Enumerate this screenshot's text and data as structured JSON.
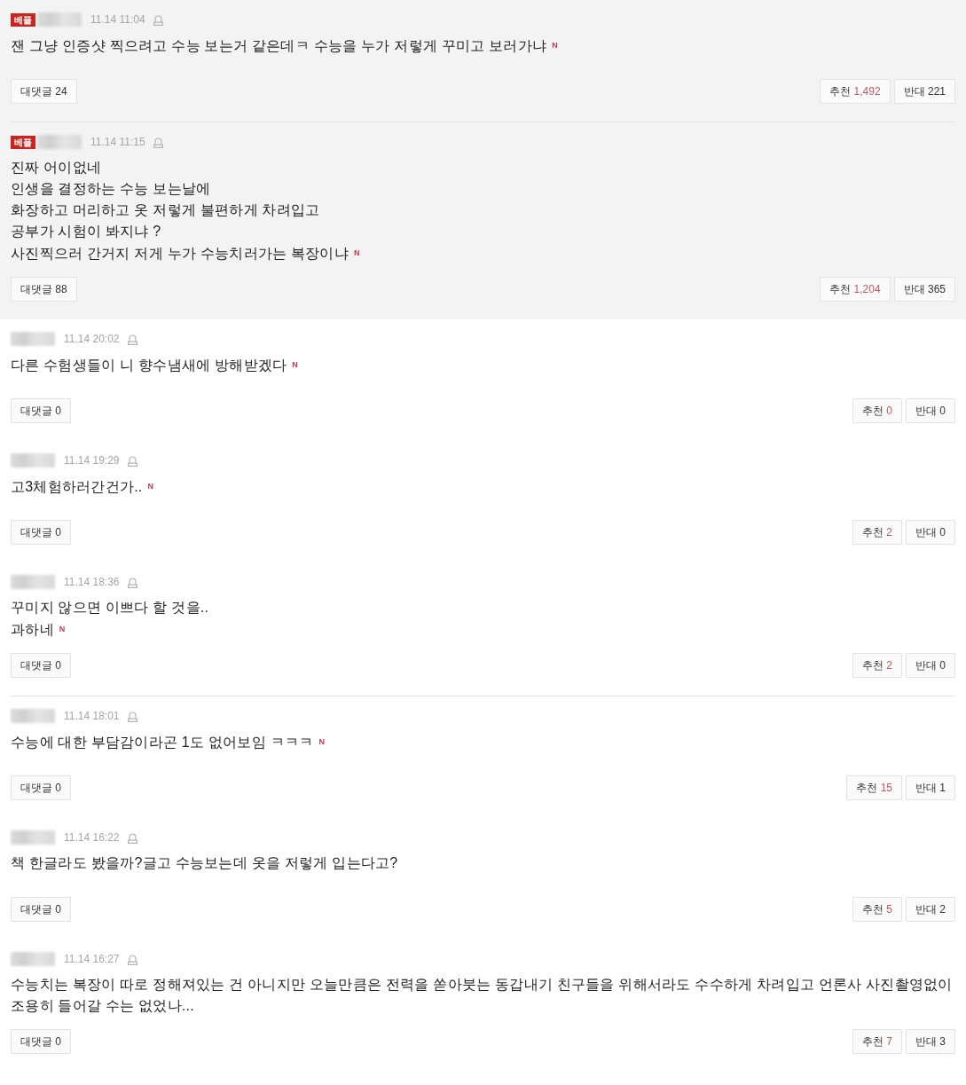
{
  "comments": [
    {
      "best": true,
      "divider": false,
      "badge": "베플",
      "date": "11.14 11:04",
      "lines": [
        "잰 그냥 인증샷 찍으려고 수능 보는거 같은데ㅋ 수능을 누가 저렇게 꾸미고 보러가냐"
      ],
      "new_mark": "N",
      "reply_button": "대댓글 24",
      "like": {
        "label": "추천",
        "count": "1,492"
      },
      "dislike": {
        "label": "반대",
        "count": "221"
      }
    },
    {
      "best": true,
      "divider": true,
      "badge": "베플",
      "date": "11.14 11:15",
      "lines": [
        "진짜 어이없네",
        "인생을 결정하는 수능 보는날에",
        "화장하고 머리하고 옷 저렇게 불편하게 차려입고",
        "공부가 시험이 봐지냐 ?",
        "사진찍으러 간거지 저게 누가 수능치러가는 복장이냐"
      ],
      "new_mark": "N",
      "reply_button": "대댓글 88",
      "like": {
        "label": "추천",
        "count": "1,204"
      },
      "dislike": {
        "label": "반대",
        "count": "365"
      }
    },
    {
      "best": false,
      "divider": false,
      "date": "11.14 20:02",
      "lines": [
        "다른 수험생들이 니 향수냄새에 방해받겠다"
      ],
      "new_mark": "N",
      "reply_button": "대댓글 0",
      "like": {
        "label": "추천",
        "count": "0"
      },
      "dislike": {
        "label": "반대",
        "count": "0"
      }
    },
    {
      "best": false,
      "divider": false,
      "date": "11.14 19:29",
      "lines": [
        "고3체험하러간건가.."
      ],
      "new_mark": "N",
      "reply_button": "대댓글 0",
      "like": {
        "label": "추천",
        "count": "2"
      },
      "dislike": {
        "label": "반대",
        "count": "0"
      }
    },
    {
      "best": false,
      "divider": false,
      "date": "11.14 18:36",
      "lines": [
        "꾸미지 않으면 이쁘다 할 것을..",
        "과하네"
      ],
      "new_mark": "N",
      "reply_button": "대댓글 0",
      "like": {
        "label": "추천",
        "count": "2"
      },
      "dislike": {
        "label": "반대",
        "count": "0"
      }
    },
    {
      "best": false,
      "divider": true,
      "date": "11.14 18:01",
      "lines": [
        "수능에 대한 부담감이라곤 1도 없어보임 ㅋㅋㅋ"
      ],
      "new_mark": "N",
      "reply_button": "대댓글 0",
      "like": {
        "label": "추천",
        "count": "15"
      },
      "dislike": {
        "label": "반대",
        "count": "1"
      }
    },
    {
      "best": false,
      "divider": false,
      "date": "11.14 16:22",
      "lines": [
        "책 한글라도 봤을까?글고 수능보는데 옷을 저렇게 입는다고?"
      ],
      "reply_button": "대댓글 0",
      "like": {
        "label": "추천",
        "count": "5"
      },
      "dislike": {
        "label": "반대",
        "count": "2"
      }
    },
    {
      "best": false,
      "divider": false,
      "date": "11.14 16:27",
      "lines": [
        "수능치는 복장이 따로 정해져있는 건 아니지만 오늘만큼은 전력을 쏟아붓는 동갑내기 친구들을 위해서라도 수수하게 차려입고 언론사 사진촬영없이 조용히 들어갈 수는 없었나..."
      ],
      "reply_button": "대댓글 0",
      "like": {
        "label": "추천",
        "count": "7"
      },
      "dislike": {
        "label": "반대",
        "count": "3"
      }
    }
  ]
}
